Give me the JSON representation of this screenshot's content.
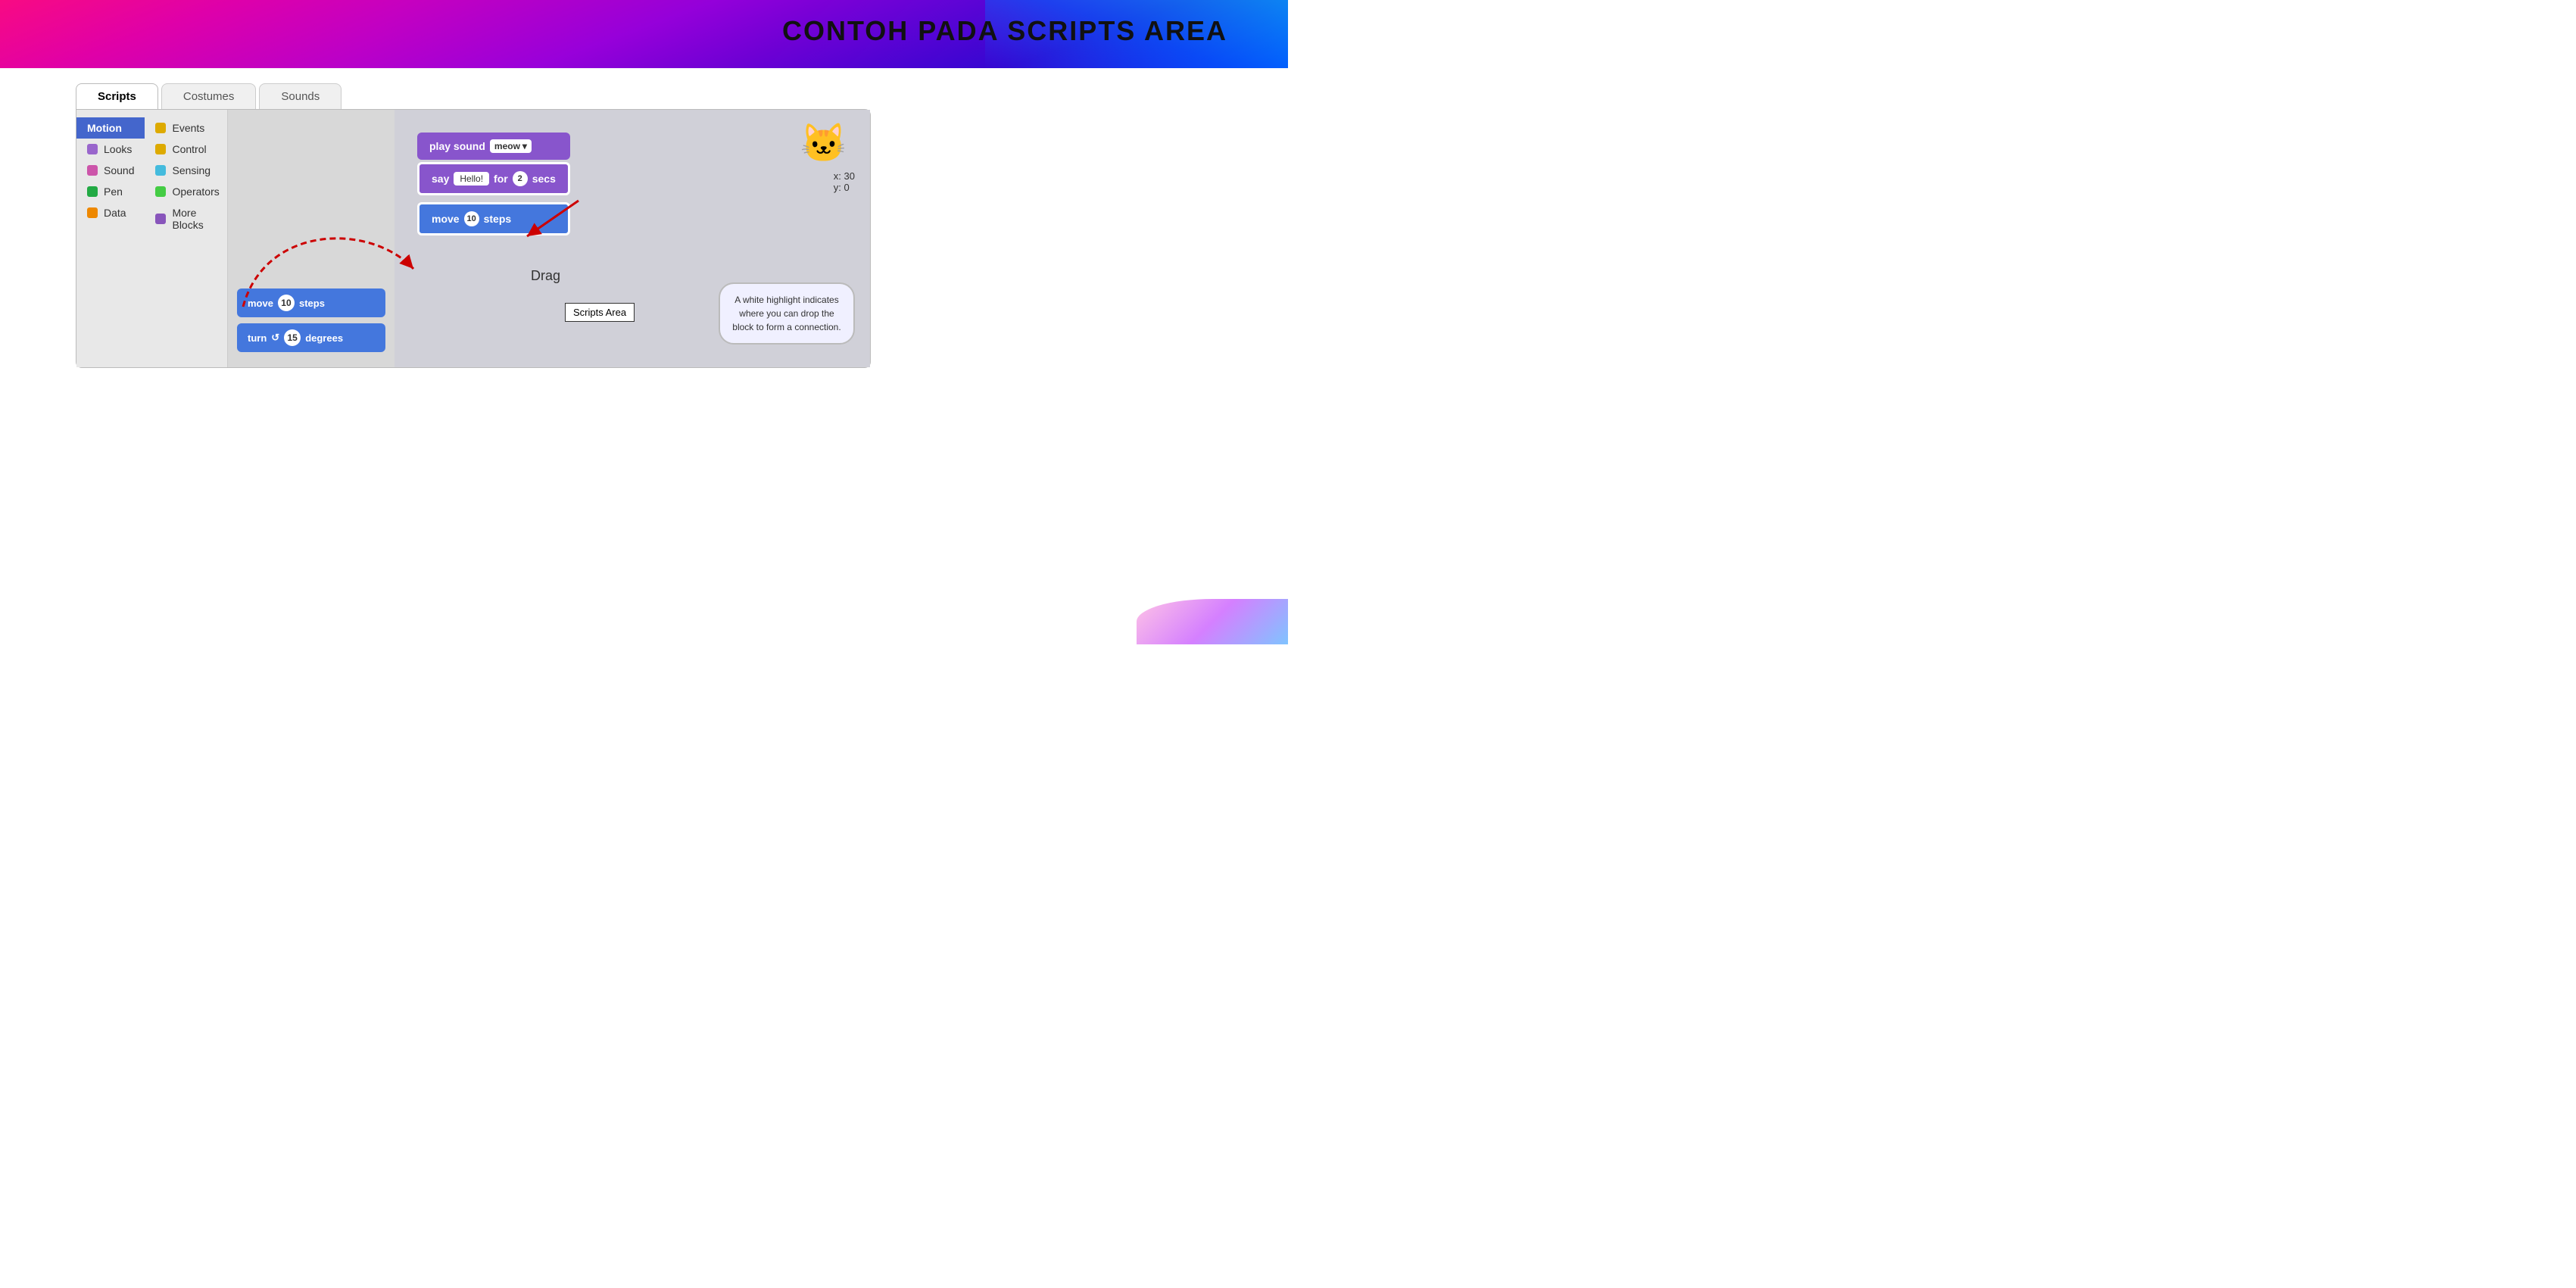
{
  "page": {
    "title": "CONTOH PADA SCRIPTS AREA"
  },
  "tabs": {
    "scripts": "Scripts",
    "costumes": "Costumes",
    "sounds": "Sounds"
  },
  "palette": {
    "left_col": [
      {
        "label": "Motion",
        "color": "#4466cc",
        "active": true
      },
      {
        "label": "Looks",
        "color": "#9966cc"
      },
      {
        "label": "Sound",
        "color": "#cc55aa"
      },
      {
        "label": "Pen",
        "color": "#22aa44"
      },
      {
        "label": "Data",
        "color": "#ee8800"
      }
    ],
    "right_col": [
      {
        "label": "Events",
        "color": "#ddaa00"
      },
      {
        "label": "Control",
        "color": "#ddaa00"
      },
      {
        "label": "Sensing",
        "color": "#44bbdd"
      },
      {
        "label": "Operators",
        "color": "#44cc44"
      },
      {
        "label": "More Blocks",
        "color": "#8855bb"
      }
    ]
  },
  "blocks_panel": {
    "move_block": {
      "prefix": "move",
      "badge": "10",
      "suffix": "steps"
    },
    "turn_block": {
      "prefix": "turn",
      "badge": "15",
      "suffix": "degrees"
    }
  },
  "scripts_area": {
    "play_sound_block": {
      "prefix": "play sound",
      "dropdown": "meow"
    },
    "say_block": {
      "prefix": "say",
      "input": "Hello!",
      "middle": "for",
      "badge": "2",
      "suffix": "secs"
    },
    "move_block": {
      "prefix": "move",
      "badge": "10",
      "suffix": "steps"
    }
  },
  "coords": {
    "x_label": "x:",
    "x_val": "30",
    "y_label": "y:",
    "y_val": "0"
  },
  "labels": {
    "drag": "Drag",
    "scripts_area": "Scripts Area",
    "callout": "A white highlight indicates where you can drop the block to form a connection."
  }
}
